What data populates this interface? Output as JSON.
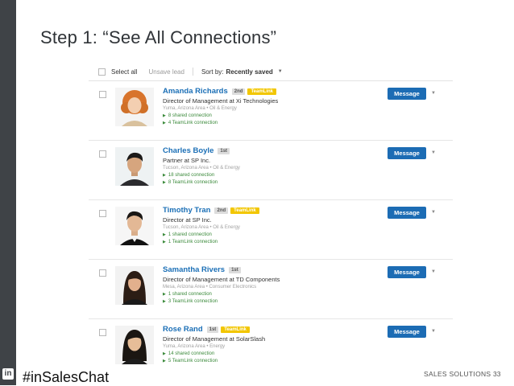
{
  "slide": {
    "title": "Step 1: “See All Connections”",
    "hashtag": "#inSalesChat",
    "footer_label": "SALES SOLUTIONS",
    "page_number": "33",
    "logo_text": "in"
  },
  "toolbar": {
    "select_all": "Select all",
    "unsave_lead": "Unsave lead",
    "sort_label": "Sort by:",
    "sort_value": "Recently saved"
  },
  "colors": {
    "accent": "#1c6cb4",
    "name_link": "#1b6fb6",
    "teamlink_badge": "#f2c600",
    "connection_link": "#3b8a3b",
    "sidebar": "#3f4347"
  },
  "leads": [
    {
      "name": "Amanda Richards",
      "degree": "2nd",
      "teamlink": "TeamLink",
      "headline": "Director of Management at Xi Technologies",
      "location_industry": "Yuma, Arizona Area  •  Oil & Energy",
      "shared": "8 shared connection",
      "teamlink_connections": "4 TeamLink connection",
      "message_label": "Message"
    },
    {
      "name": "Charles Boyle",
      "degree": "1st",
      "teamlink": "",
      "headline": "Partner at SP Inc.",
      "location_industry": "Tucson, Arizona Area  •  Oil & Energy",
      "shared": "18 shared connection",
      "teamlink_connections": "8 TeamLink connection",
      "message_label": "Message"
    },
    {
      "name": "Timothy Tran",
      "degree": "2nd",
      "teamlink": "TeamLink",
      "headline": "Director at SP Inc.",
      "location_industry": "Tucson, Arizona Area  •  Oil & Energy",
      "shared": "1 shared connection",
      "teamlink_connections": "1 TeamLink connection",
      "message_label": "Message"
    },
    {
      "name": "Samantha Rivers",
      "degree": "1st",
      "teamlink": "",
      "headline": "Director of Management at TD Components",
      "location_industry": "Mesa, Arizona Area  •  Consumer Electronics",
      "shared": "1 shared connection",
      "teamlink_connections": "3 TeamLink connection",
      "message_label": "Message"
    },
    {
      "name": "Rose Rand",
      "degree": "1st",
      "teamlink": "TeamLink",
      "headline": "Director of Management at SolarSlash",
      "location_industry": "Yuma, Arizona Area  •  Energy",
      "shared": "14 shared connection",
      "teamlink_connections": "5 TeamLink connection",
      "message_label": "Message"
    }
  ]
}
